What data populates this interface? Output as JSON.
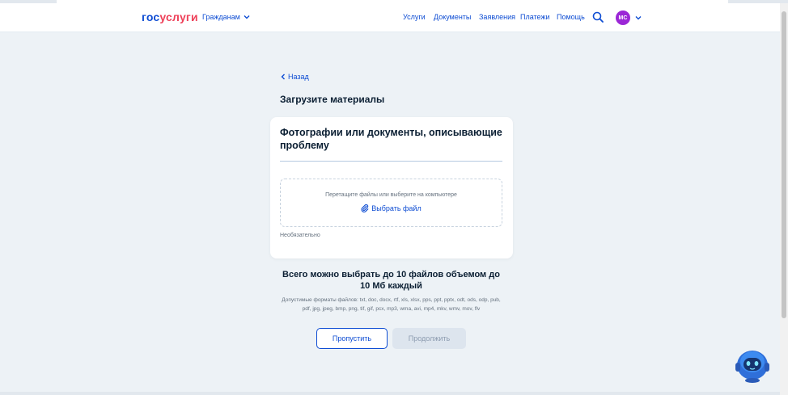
{
  "header": {
    "logo_part1": "гос",
    "logo_part2": "услуги",
    "citizens_label": "Гражданам",
    "nav": [
      {
        "label": "Услуги"
      },
      {
        "label": "Документы"
      },
      {
        "label": "Заявления"
      },
      {
        "label": "Платежи"
      },
      {
        "label": "Помощь"
      }
    ],
    "avatar_initials": "МС"
  },
  "back_label": "Назад",
  "page_title": "Загрузите материалы",
  "card": {
    "title": "Фотографии или документы, описывающие проблему",
    "dropzone_hint": "Перетащите файлы или выберите на компьютере",
    "choose_file_label": "Выбрать файл",
    "optional_label": "Необязательно"
  },
  "limits": {
    "title": "Всего можно выбрать до 10 файлов объемом до 10 Мб каждый",
    "formats": "Допустимые форматы файлов: txt, doc, docx, rtf, xls, xlsx, pps, ppt, pptx, odt, ods, odp, pub, pdf, jpg, jpeg, bmp, png, tif, gif, pcx, mp3, wma, avi, mp4, mkv, wmv, mov, flv"
  },
  "buttons": {
    "skip": "Пропустить",
    "continue": "Продолжить"
  },
  "colors": {
    "brand_blue": "#0d4cd3",
    "brand_red": "#ee3f58",
    "avatar": "#9b27d6",
    "background": "#edf2f6"
  },
  "icons": [
    "chevron-down-icon",
    "search-icon",
    "chevron-left-icon",
    "paperclip-icon",
    "assistant-robot-icon"
  ]
}
